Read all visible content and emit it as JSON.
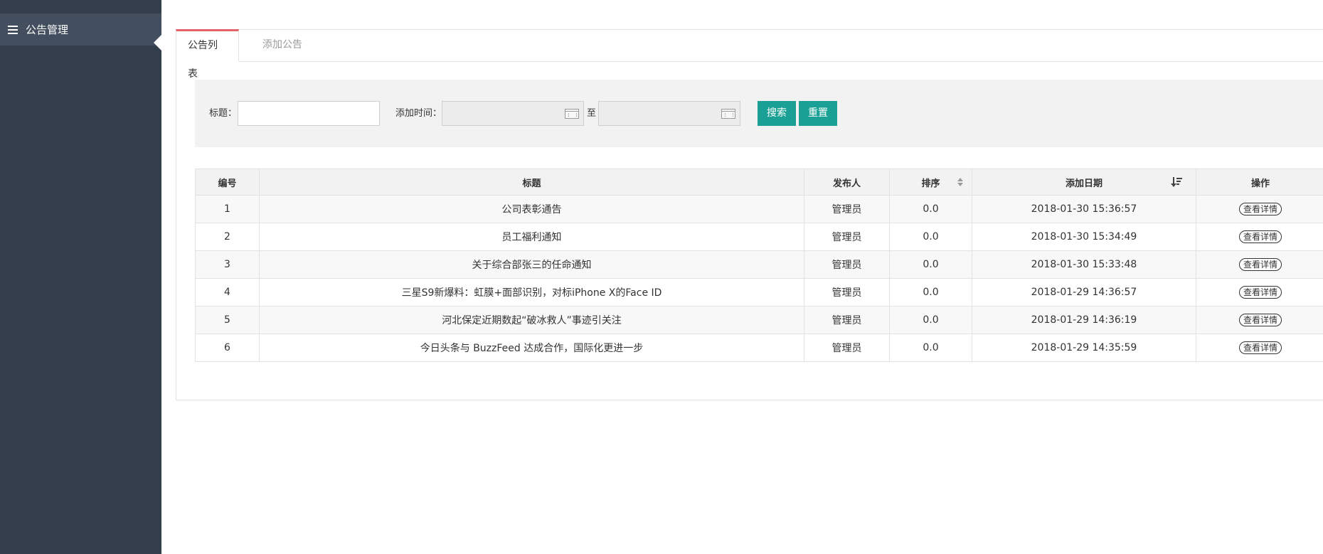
{
  "sidebar": {
    "items": [
      {
        "label": "公告管理",
        "icon": "menu-icon"
      }
    ]
  },
  "tabs": [
    {
      "label": "公告列表",
      "active": true
    },
    {
      "label": "添加公告",
      "active": false
    }
  ],
  "search": {
    "title_label": "标题：",
    "title_value": "",
    "time_label": "添加时间：",
    "start_value": "",
    "to_label": "至",
    "end_value": "",
    "search_button": "搜索",
    "reset_button": "重置"
  },
  "table": {
    "headers": [
      "编号",
      "标题",
      "发布人",
      "排序",
      "添加日期",
      "操作"
    ],
    "rows": [
      {
        "id": "1",
        "title": "公司表彰通告",
        "publisher": "管理员",
        "sort": "0.0",
        "date": "2018-01-30 15:36:57",
        "action": "查看详情"
      },
      {
        "id": "2",
        "title": "员工福利通知",
        "publisher": "管理员",
        "sort": "0.0",
        "date": "2018-01-30 15:34:49",
        "action": "查看详情"
      },
      {
        "id": "3",
        "title": "关于综合部张三的任命通知",
        "publisher": "管理员",
        "sort": "0.0",
        "date": "2018-01-30 15:33:48",
        "action": "查看详情"
      },
      {
        "id": "4",
        "title": "三星S9新爆料：虹膜+面部识别，对标iPhone X的Face ID",
        "publisher": "管理员",
        "sort": "0.0",
        "date": "2018-01-29 14:36:57",
        "action": "查看详情"
      },
      {
        "id": "5",
        "title": "河北保定近期数起“破冰救人”事迹引关注",
        "publisher": "管理员",
        "sort": "0.0",
        "date": "2018-01-29 14:36:19",
        "action": "查看详情"
      },
      {
        "id": "6",
        "title": "今日头条与 BuzzFeed 达成合作，国际化更进一步",
        "publisher": "管理员",
        "sort": "0.0",
        "date": "2018-01-29 14:35:59",
        "action": "查看详情"
      }
    ]
  },
  "colors": {
    "sidebar_bg": "#333d4c",
    "sidebar_active_bg": "#434f5f",
    "accent_button": "#1aa094",
    "tab_active_border": "#e36466"
  }
}
